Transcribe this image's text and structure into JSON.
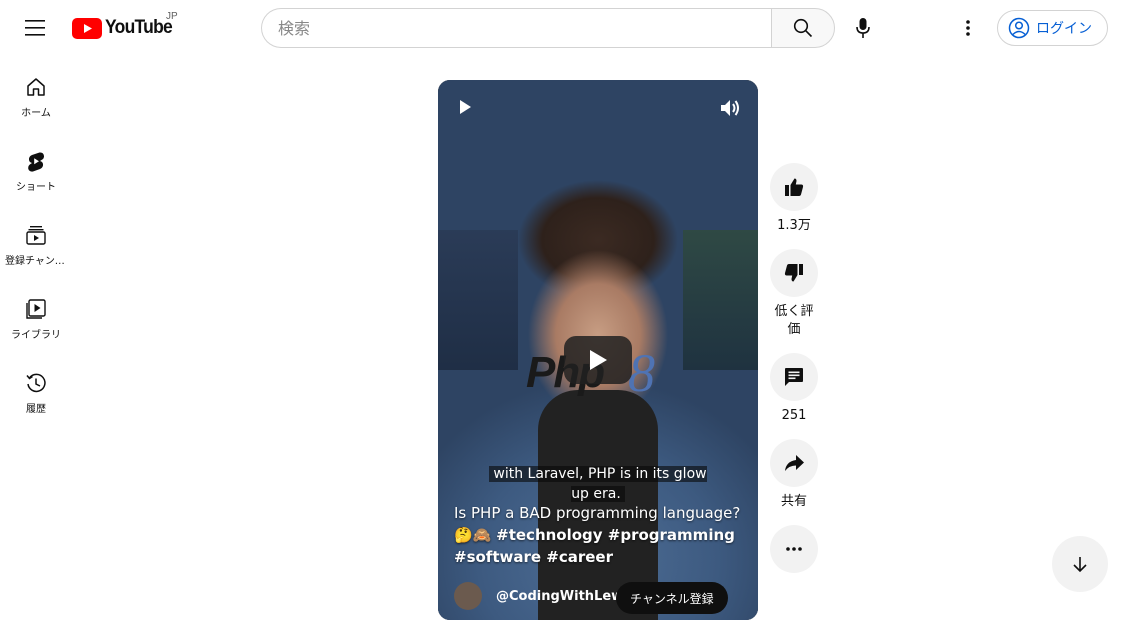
{
  "header": {
    "logo_text": "YouTube",
    "region": "JP",
    "search_placeholder": "検索",
    "signin_label": "ログイン"
  },
  "sidebar": {
    "items": [
      {
        "label": "ホーム",
        "icon": "home-icon"
      },
      {
        "label": "ショート",
        "icon": "shorts-icon"
      },
      {
        "label": "登録チャンネル",
        "icon": "subscriptions-icon"
      },
      {
        "label": "ライブラリ",
        "icon": "library-icon"
      },
      {
        "label": "履歴",
        "icon": "history-icon"
      }
    ]
  },
  "short": {
    "caption": "with Laravel, PHP is in its glow up era.",
    "title_text": "Is PHP a BAD programming language?",
    "emoji": "🤔🙈",
    "hashtags": "#technology #programming #software #career",
    "channel": "@CodingWithLewi",
    "subscribe_label": "チャンネル登録",
    "logo_overlay": "Php",
    "logo_version": "8"
  },
  "actions": {
    "like_count": "1.3万",
    "dislike_label": "低く評価",
    "comment_count": "251",
    "share_label": "共有"
  },
  "colors": {
    "brand_red": "#ff0000",
    "link_blue": "#065fd4",
    "action_bg": "#f2f2f2"
  }
}
